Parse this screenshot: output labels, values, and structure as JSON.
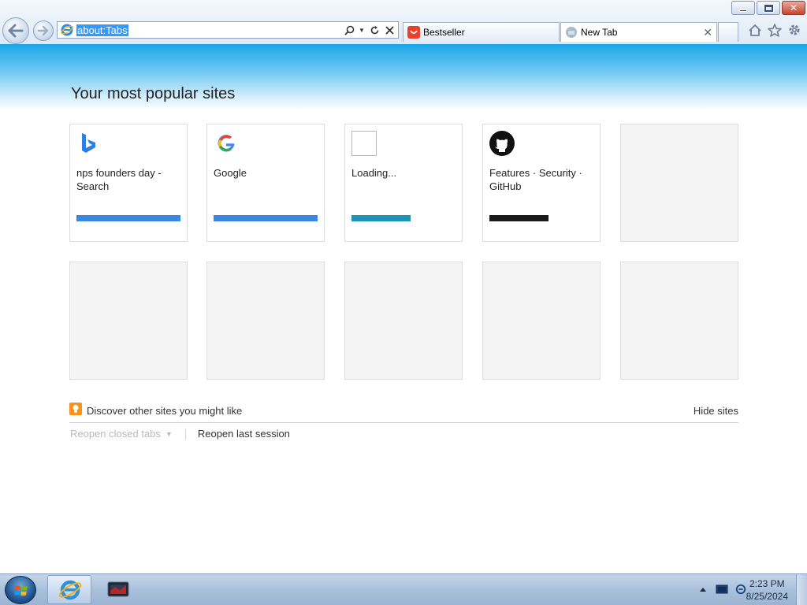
{
  "browser": {
    "address": {
      "url": "about:Tabs"
    },
    "tabs": [
      {
        "label": "Bestseller",
        "active": false
      },
      {
        "label": "New Tab",
        "active": true
      }
    ],
    "window_controls": [
      "minimize-icon",
      "restore-icon",
      "close-icon"
    ],
    "toolbar_icons": [
      "home-icon",
      "star-icon",
      "gear-icon"
    ],
    "address_icons": [
      "search-icon",
      "dropdown-icon",
      "refresh-icon",
      "stop-icon"
    ]
  },
  "page": {
    "title": "Your most popular sites",
    "tiles": [
      {
        "title": "nps founders day - Search",
        "icon": "bing-icon",
        "bar_color": "#3a86e3"
      },
      {
        "title": "Google",
        "icon": "google-icon",
        "bar_color": "#3a86e3"
      },
      {
        "title": "Loading...",
        "icon": "blank-page-icon",
        "bar_color": "#1e93b5"
      },
      {
        "title": "Features · Security · GitHub",
        "icon": "github-icon",
        "bar_color": "#1a1a1a"
      },
      {
        "title": "",
        "icon": "",
        "bar_color": ""
      },
      {
        "title": "",
        "icon": "",
        "bar_color": ""
      },
      {
        "title": "",
        "icon": "",
        "bar_color": ""
      },
      {
        "title": "",
        "icon": "",
        "bar_color": ""
      },
      {
        "title": "",
        "icon": "",
        "bar_color": ""
      },
      {
        "title": "",
        "icon": "",
        "bar_color": ""
      }
    ],
    "discover_text": "Discover other sites you might like",
    "hide_sites": "Hide sites",
    "reopen_closed_tabs": "Reopen closed tabs",
    "reopen_last_session": "Reopen last session"
  },
  "taskbar": {
    "time": "2:23 PM",
    "date": "8/25/2024",
    "tray_icons": [
      "show-hidden-icon",
      "action-center-icon",
      "network-icon"
    ]
  },
  "colors": {
    "accent": "#1aa7e8",
    "selection": "#3399ff"
  }
}
